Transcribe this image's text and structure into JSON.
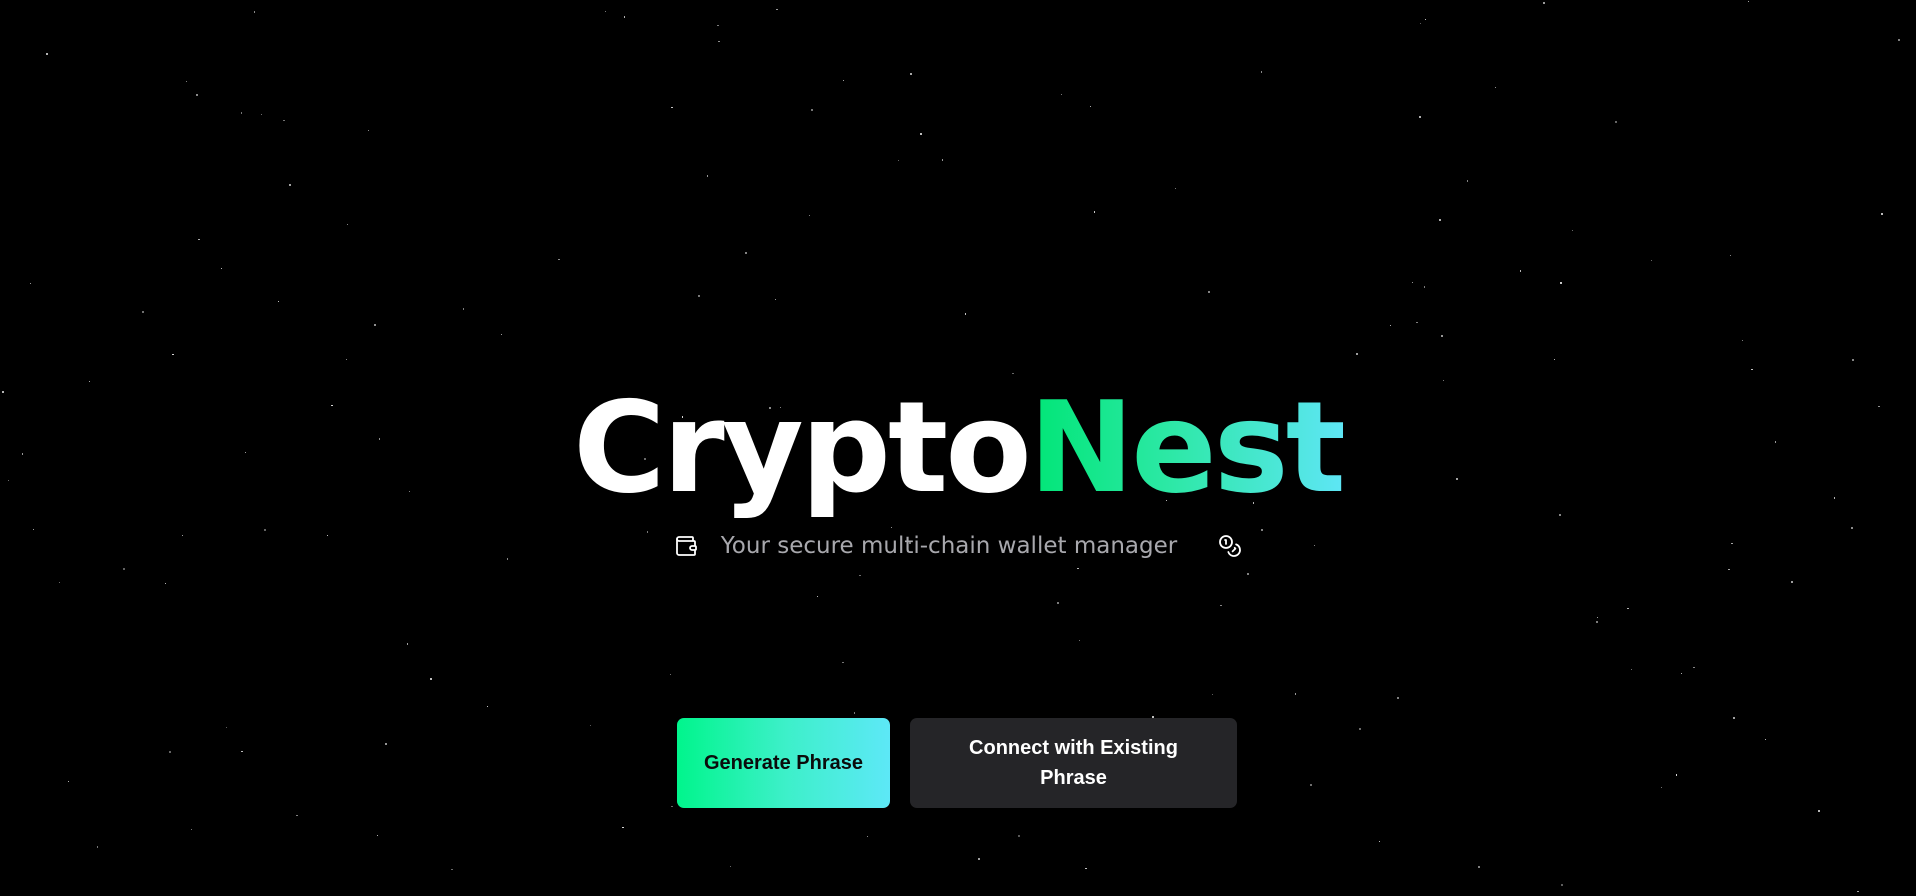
{
  "app": {
    "brand_part_1": "Crypto",
    "brand_part_2": "Nest",
    "tagline": "Your secure multi-chain wallet manager"
  },
  "icons": {
    "left": "wallet-icon",
    "right": "coins-icon"
  },
  "actions": {
    "primary_label": "Generate Phrase",
    "secondary_label": "Connect with Existing Phrase"
  },
  "colors": {
    "background": "#000000",
    "brand_gradient_start": "#00e676",
    "brand_gradient_end": "#5ee6f5",
    "primary_button_start": "#00f58c",
    "primary_button_end": "#5de8f7",
    "secondary_button": "#252528",
    "tagline_text": "#a8a8ad"
  }
}
